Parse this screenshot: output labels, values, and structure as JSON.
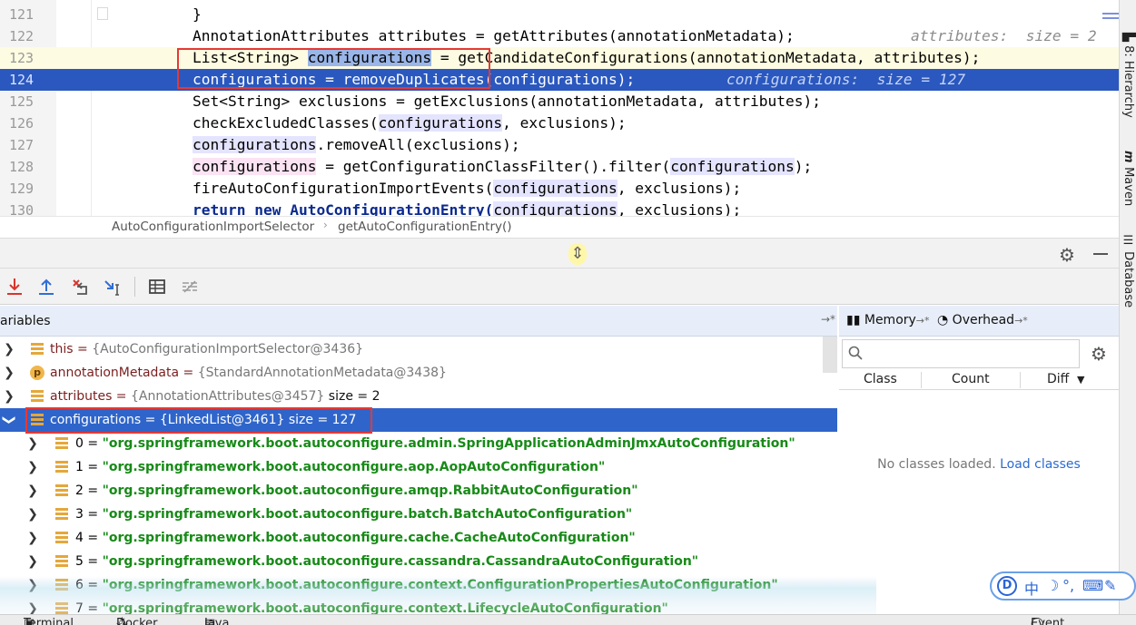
{
  "editor": {
    "lines": [
      {
        "num": "121",
        "text": "}"
      },
      {
        "num": "122",
        "text": "AnnotationAttributes attributes = getAttributes(annotationMetadata);",
        "hint": "attributes:  size = 2"
      },
      {
        "num": "123",
        "pre": "List<String> ",
        "var": "configurations",
        "post": " = getCandidateConfigurations(annotationMetadata, attributes);"
      },
      {
        "num": "124",
        "text": "configurations = removeDuplicates(configurations);",
        "hint": "configurations:  size = 127"
      },
      {
        "num": "125",
        "text": "Set<String> exclusions = getExclusions(annotationMetadata, attributes);"
      },
      {
        "num": "126",
        "pre": "checkExcludedClasses(",
        "var": "configurations",
        "post": ", exclusions);"
      },
      {
        "num": "127",
        "var": "configurations",
        "post": ".removeAll(exclusions);"
      },
      {
        "num": "128",
        "var": "configurations",
        "mid": " = getConfigurationClassFilter().filter(",
        "var2": "configurations",
        "post": ");"
      },
      {
        "num": "129",
        "pre": "fireAutoConfigurationImportEvents(",
        "var": "configurations",
        "post": ", exclusions);"
      },
      {
        "num": "130",
        "pre": "return new AutoConfigurationEntry(",
        "var": "configurations",
        "post": ", exclusions);"
      }
    ]
  },
  "breadcrumb": {
    "class_name": "AutoConfigurationImportSelector",
    "method_name": "getAutoConfigurationEntry()",
    "separator": "›"
  },
  "debug": {
    "resize_handle": "⇕",
    "toolbar_icons": [
      "step-into-icon",
      "step-out-icon",
      "drop-frame-icon",
      "run-to-cursor-icon",
      "evaluate-icon",
      "trace-icon"
    ]
  },
  "variables": {
    "title": "ariables",
    "pin": "→*",
    "rows": [
      {
        "name": "this",
        "value": "{AutoConfigurationImportSelector@3436}",
        "size": "",
        "icon": "field"
      },
      {
        "name": "annotationMetadata",
        "value": "{StandardAnnotationMetadata@3438}",
        "size": "",
        "icon": "param"
      },
      {
        "name": "attributes",
        "value": "{AnnotationAttributes@3457}",
        "size": "size = 2",
        "icon": "field"
      },
      {
        "name": "configurations",
        "value": "{LinkedList@3461}",
        "size": "size = 127",
        "icon": "field"
      }
    ],
    "children": [
      {
        "index": "0",
        "value": "\"org.springframework.boot.autoconfigure.admin.SpringApplicationAdminJmxAutoConfiguration\""
      },
      {
        "index": "1",
        "value": "\"org.springframework.boot.autoconfigure.aop.AopAutoConfiguration\""
      },
      {
        "index": "2",
        "value": "\"org.springframework.boot.autoconfigure.amqp.RabbitAutoConfiguration\""
      },
      {
        "index": "3",
        "value": "\"org.springframework.boot.autoconfigure.batch.BatchAutoConfiguration\""
      },
      {
        "index": "4",
        "value": "\"org.springframework.boot.autoconfigure.cache.CacheAutoConfiguration\""
      },
      {
        "index": "5",
        "value": "\"org.springframework.boot.autoconfigure.cassandra.CassandraAutoConfiguration\""
      },
      {
        "index": "6",
        "value": "\"org.springframework.boot.autoconfigure.context.ConfigurationPropertiesAutoConfiguration\""
      },
      {
        "index": "7",
        "value": "\"org.springframework.boot.autoconfigure.context.LifecycleAutoConfiguration\""
      }
    ]
  },
  "memory": {
    "tab_memory": "Memory",
    "tab_overhead": "Overhead",
    "tab_pin": "→*",
    "search_placeholder": "",
    "col_class": "Class",
    "col_count": "Count",
    "col_diff": "Diff",
    "empty_text": "No classes loaded.",
    "load_link": "Load classes"
  },
  "right_strip": {
    "hierarchy": "8: Hierarchy",
    "maven": "Maven",
    "database": "Database"
  },
  "ime": {
    "lang": "中",
    "moon": "☽",
    "punct": "°,",
    "keyboard": "⌨",
    "tool": "✎"
  },
  "bottom_bar": {
    "terminal": "Terminal",
    "docker": "Docker",
    "java_ee": "Java Enterprise",
    "event_log": "Event Log"
  },
  "colors": {
    "selection_blue": "#2a58bf",
    "tree_selected": "#2f65ca",
    "string_green": "#178a17",
    "red_highlight": "#e53935"
  }
}
